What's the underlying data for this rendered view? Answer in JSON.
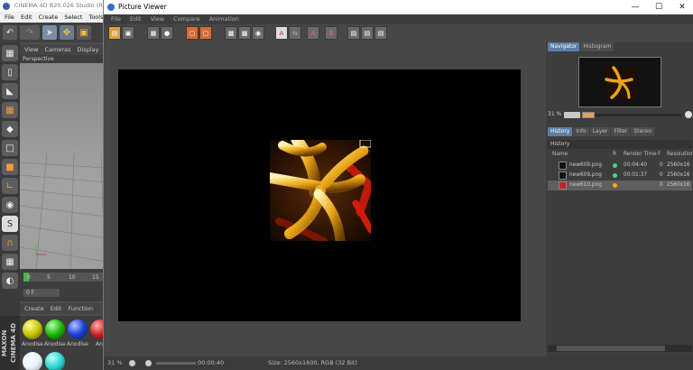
{
  "c4d": {
    "title": "CINEMA 4D R20.026 Studio (RC",
    "menu": [
      "File",
      "Edit",
      "Create",
      "Select",
      "Tools"
    ],
    "viewport_menu": [
      "View",
      "Cameras",
      "Display"
    ],
    "viewport_label": "Perspective",
    "timeline_ticks": [
      "0",
      "5",
      "10",
      "15"
    ],
    "frame_field": "0 F",
    "material_menu": [
      "Create",
      "Edit",
      "Function"
    ],
    "materials": [
      "Anodise",
      "Anodise",
      "Anodise",
      "An"
    ],
    "brand": "MAXON CINEMA 4D"
  },
  "viewer": {
    "title": "Picture Viewer",
    "menu": [
      "File",
      "Edit",
      "View",
      "Compare",
      "Animation"
    ],
    "window_controls": [
      "—",
      "☐",
      "✕"
    ],
    "status": {
      "zoom": "31 %",
      "time": "00:00:40",
      "size": "Size: 2560x1600, RGB (32 Bit)"
    },
    "right_panel": {
      "top_tabs": [
        "Navigator",
        "Histogram"
      ],
      "zoom": "31 %",
      "tabs": [
        "History",
        "Info",
        "Layer",
        "Filter",
        "Stereo"
      ],
      "history_label": "History",
      "columns": [
        "Name",
        "R",
        "Render Time",
        "F",
        "Resolution"
      ],
      "rows": [
        {
          "name": "new608.png",
          "time": "00:04:40",
          "f": "0",
          "res": "2560x16",
          "status_color": "#3ddc84"
        },
        {
          "name": "new609.png",
          "time": "00:01:37",
          "f": "0",
          "res": "2560x16",
          "status_color": "#3ddc84"
        },
        {
          "name": "new610.png",
          "time": "",
          "f": "0",
          "res": "2560x16",
          "status_color": "#f5a623"
        }
      ]
    }
  }
}
